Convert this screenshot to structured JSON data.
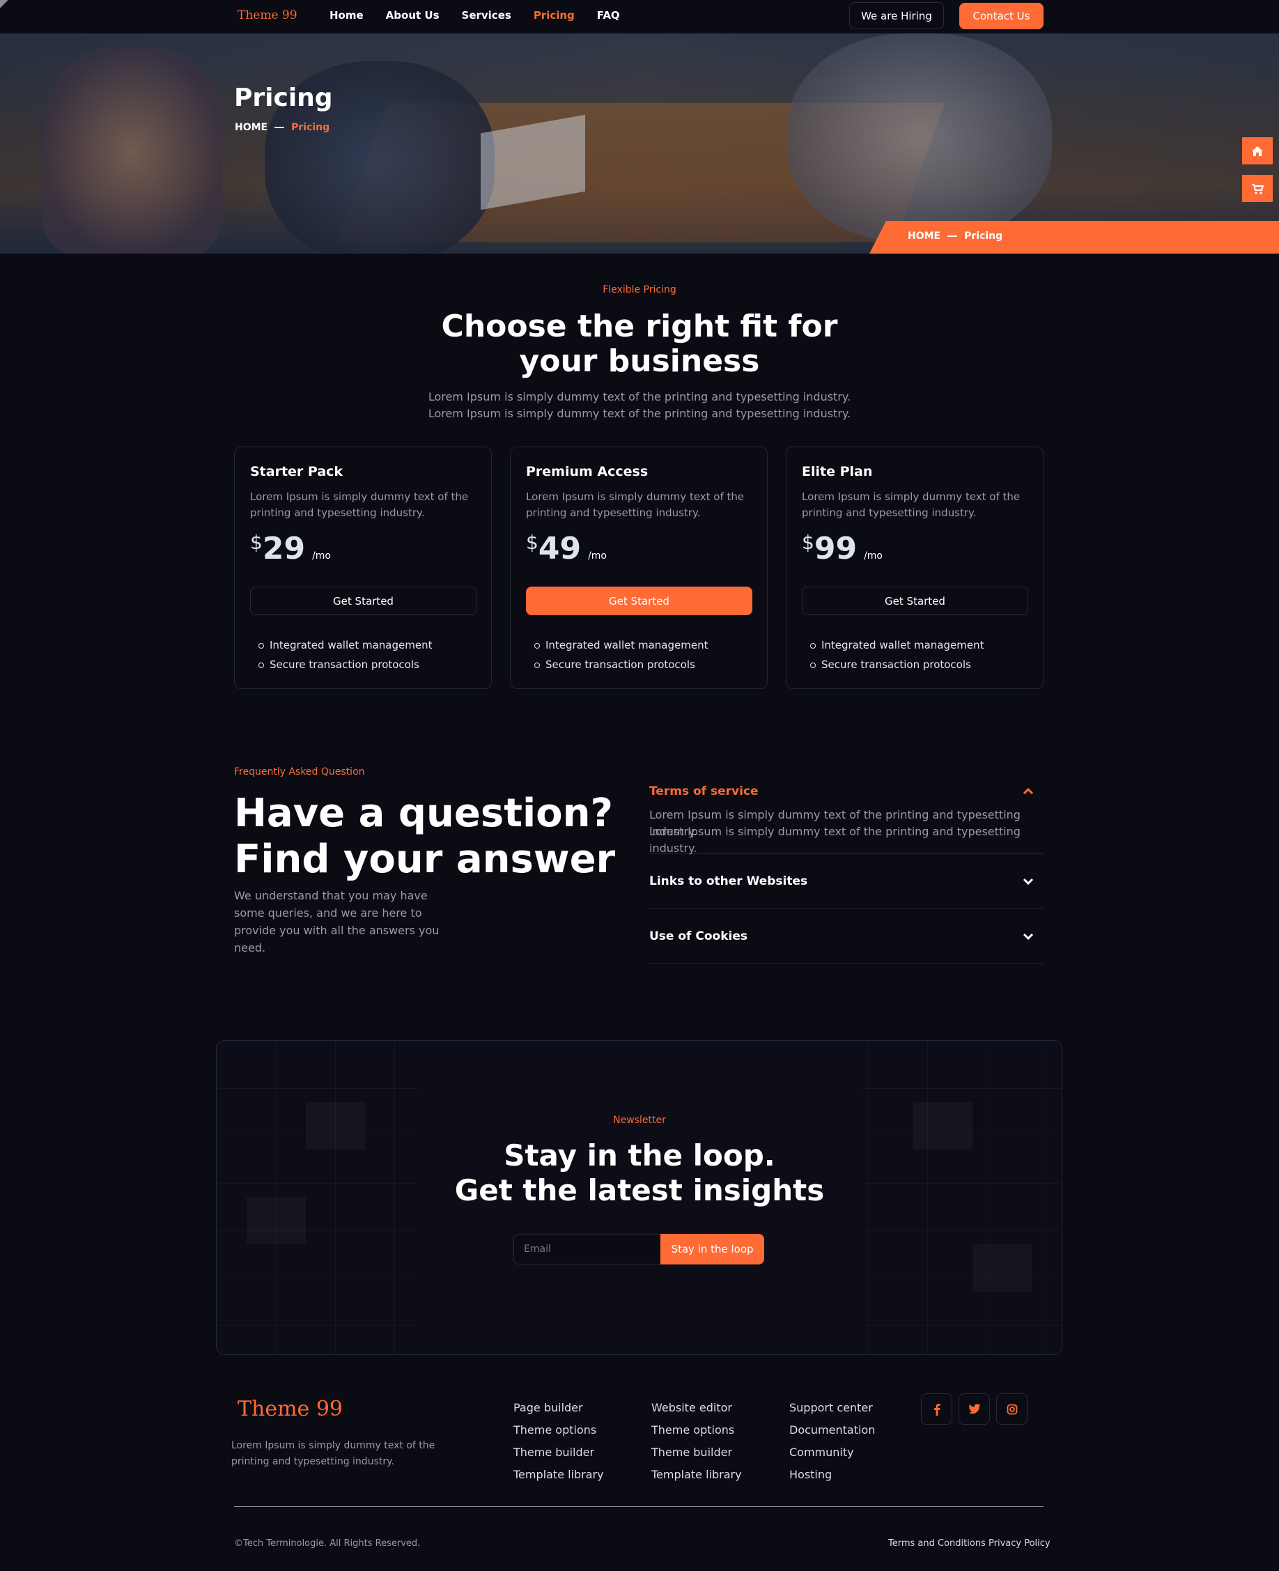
{
  "brand": {
    "name": "Theme 99",
    "accent": "#ff6b35",
    "background": "#0b0b14"
  },
  "nav": {
    "links": [
      "Home",
      "About Us",
      "Services",
      "Pricing",
      "FAQ"
    ],
    "active": "Pricing",
    "hiring_label": "We are Hiring",
    "contact_label": "Contact Us"
  },
  "hero": {
    "title": "Pricing",
    "breadcrumb": {
      "home": "HOME",
      "current": "Pricing"
    },
    "side_icons": [
      "home-icon",
      "cart-icon"
    ]
  },
  "pricing": {
    "eyebrow": "Flexible Pricing",
    "title_line1": "Choose the right fit for",
    "title_line2": "your business",
    "subtitle_line1": "Lorem Ipsum is simply dummy text of the printing and typesetting industry.",
    "subtitle_line2": "Lorem Ipsum is simply dummy text of the printing and typesetting industry.",
    "plans": [
      {
        "name": "Starter Pack",
        "desc": "Lorem Ipsum is simply dummy text of the printing and typesetting industry.",
        "currency": "$",
        "amount": "29",
        "period": "/mo",
        "cta": "Get Started",
        "features": [
          "Integrated wallet management",
          "Secure transaction protocols"
        ]
      },
      {
        "name": "Premium Access",
        "desc": "Lorem Ipsum is simply dummy text of the printing and typesetting industry.",
        "currency": "$",
        "amount": "49",
        "period": "/mo",
        "cta": "Get Started",
        "features": [
          "Integrated wallet management",
          "Secure transaction protocols"
        ]
      },
      {
        "name": "Elite Plan",
        "desc": "Lorem Ipsum is simply dummy text of the printing and typesetting industry.",
        "currency": "$",
        "amount": "99",
        "period": "/mo",
        "cta": "Get Started",
        "features": [
          "Integrated wallet management",
          "Secure transaction protocols"
        ]
      }
    ]
  },
  "faq": {
    "eyebrow": "Frequently Asked Question",
    "title_line1": "Have a question?",
    "title_line2": "Find your answer",
    "subtitle": "We understand that you may have some queries, and we are here to provide you with all the answers you need.",
    "items": [
      {
        "question": "Terms of service",
        "answer_line1": "Lorem Ipsum is simply dummy text of the printing and typesetting industry.",
        "answer_line2": "Lorem Ipsum is simply dummy text of the printing and typesetting industry."
      },
      {
        "question": "Links to other Websites"
      },
      {
        "question": "Use of Cookies"
      }
    ]
  },
  "newsletter": {
    "eyebrow": "Newsletter",
    "title_line1": "Stay in the loop.",
    "title_line2": "Get the latest insights",
    "email_placeholder": "Email",
    "button_label": "Stay in the loop"
  },
  "footer": {
    "logo": "Theme 99",
    "description": "Lorem Ipsum is simply dummy text of the printing and typesetting industry.",
    "columns": [
      [
        "Page builder",
        "Theme options",
        "Theme builder",
        "Template library"
      ],
      [
        "Website editor",
        "Theme options",
        "Theme builder",
        "Template library"
      ],
      [
        "Support center",
        "Documentation",
        "Community",
        "Hosting"
      ]
    ],
    "social": [
      "facebook-icon",
      "twitter-icon",
      "instagram-icon"
    ],
    "copyright": "©Tech Terminologie. All Rights Reserved.",
    "legal": [
      "Terms and Conditions",
      "Privacy Policy"
    ]
  }
}
